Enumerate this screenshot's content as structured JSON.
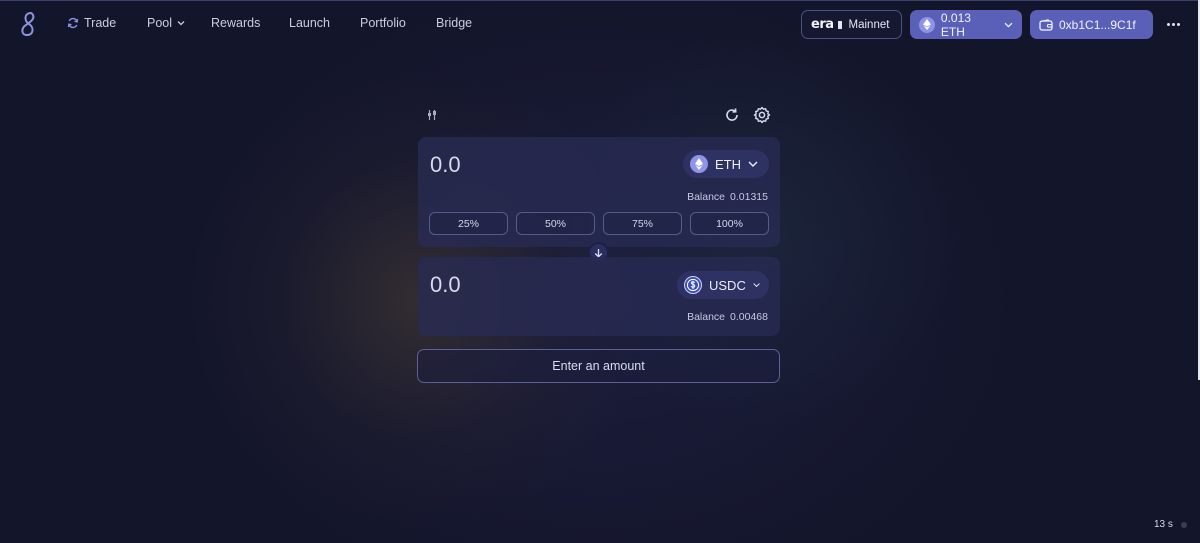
{
  "nav": {
    "items": [
      {
        "label": "Trade",
        "icon": "sync-icon"
      },
      {
        "label": "Pool",
        "icon": "chevron-down-icon"
      },
      {
        "label": "Rewards"
      },
      {
        "label": "Launch"
      },
      {
        "label": "Portfolio"
      },
      {
        "label": "Bridge"
      }
    ],
    "network": {
      "logo_text": "era",
      "label": "Mainnet"
    },
    "eth_balance": "0.013 ETH",
    "wallet_address": "0xb1C1...9C1f"
  },
  "swap": {
    "from": {
      "amount_placeholder": "0.0",
      "token": "ETH",
      "balance_label": "Balance",
      "balance_value": "0.01315"
    },
    "percent_buttons": [
      "25%",
      "50%",
      "75%",
      "100%"
    ],
    "to": {
      "amount_placeholder": "0.0",
      "token": "USDC",
      "balance_label": "Balance",
      "balance_value": "0.00468"
    },
    "submit_label": "Enter an amount"
  },
  "status": {
    "block_timer": "13 s"
  },
  "colors": {
    "background": "#13152a",
    "accent": "#5a5fb8",
    "panel": "#282b52"
  }
}
